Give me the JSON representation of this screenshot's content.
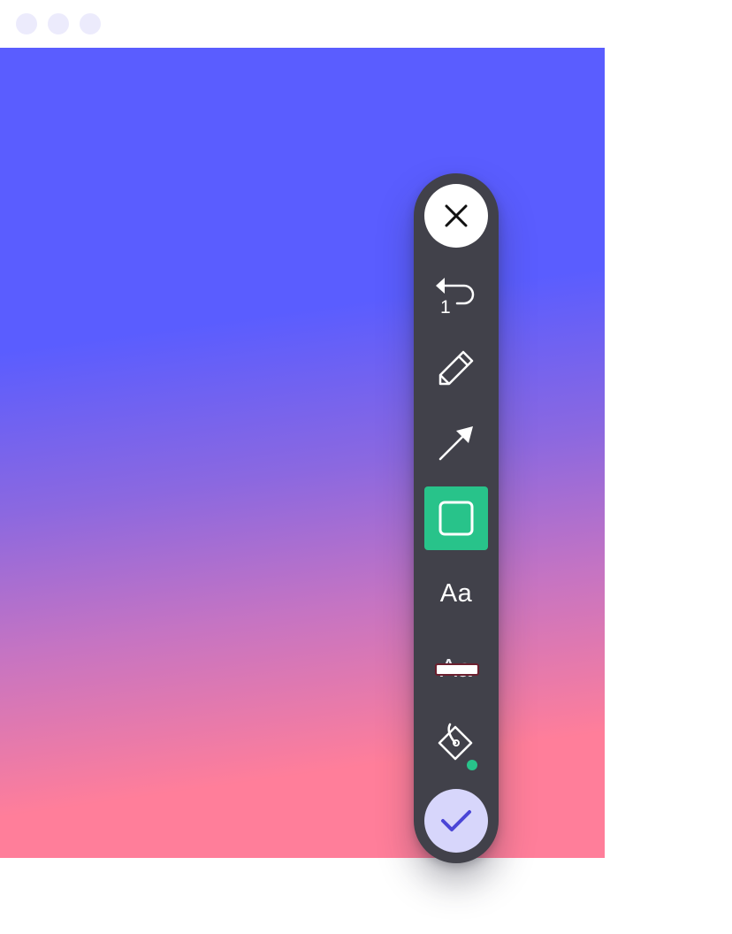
{
  "window": {
    "controls": [
      "window-dot",
      "window-dot",
      "window-dot"
    ]
  },
  "canvas": {
    "gradient_colors": [
      "#5a5dff",
      "#8b68e0",
      "#c674c2",
      "#ff7e9a"
    ]
  },
  "toolbar": {
    "background_color": "#41414a",
    "close": {
      "icon": "close-icon"
    },
    "undo": {
      "icon": "undo-icon",
      "count": "1"
    },
    "pencil": {
      "icon": "pencil-icon"
    },
    "arrow": {
      "icon": "arrow-icon"
    },
    "rectangle": {
      "icon": "rectangle-icon",
      "selected": true,
      "active_color": "#28c38a"
    },
    "text": {
      "icon": "text-icon",
      "label": "Aa"
    },
    "highlight": {
      "icon": "highlight-text-icon",
      "label": "Aa"
    },
    "fill": {
      "icon": "paint-bucket-icon",
      "color": "#28c38a"
    },
    "confirm": {
      "icon": "checkmark-icon",
      "color": "#4a45d6"
    }
  }
}
